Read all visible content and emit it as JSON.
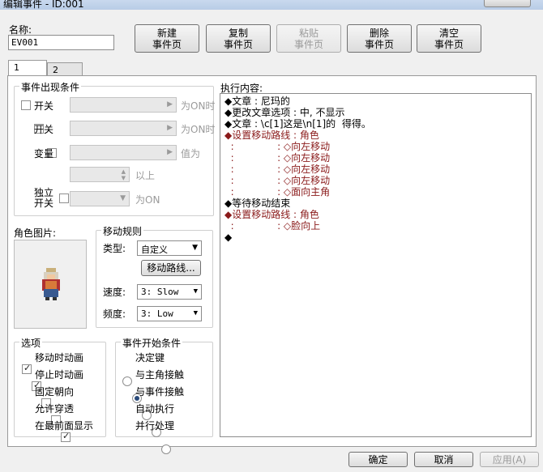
{
  "window": {
    "title": "编辑事件 - ID:001"
  },
  "name_field": {
    "label": "名称:",
    "value": "EV001"
  },
  "toolbar": {
    "new_page": [
      "新建",
      "事件页"
    ],
    "copy_page": [
      "复制",
      "事件页"
    ],
    "paste_page": [
      "粘贴",
      "事件页"
    ],
    "delete_page": [
      "删除",
      "事件页"
    ],
    "clear_page": [
      "清空",
      "事件页"
    ]
  },
  "tabs": [
    "1",
    "2"
  ],
  "conditions": {
    "title": "事件出现条件",
    "switch1": {
      "label": "开关",
      "suffix": "为ON时"
    },
    "switch2": {
      "label": "开关",
      "suffix": "为ON时"
    },
    "variable": {
      "label": "变量",
      "suffix": "值为",
      "above": "以上"
    },
    "self_switch": {
      "label1": "独立",
      "label2": "开关",
      "suffix": "为ON"
    }
  },
  "graphic": {
    "title": "角色图片:"
  },
  "movement": {
    "title": "移动规则",
    "type_label": "类型:",
    "type_value": "自定义",
    "route_button": "移动路线...",
    "speed_label": "速度:",
    "speed_value": "3: Slow",
    "freq_label": "频度:",
    "freq_value": "3: Low"
  },
  "options": {
    "title": "选项",
    "items": [
      {
        "label": "移动时动画",
        "checked": true
      },
      {
        "label": "停止时动画",
        "checked": true
      },
      {
        "label": "固定朝向",
        "checked": false
      },
      {
        "label": "允许穿透",
        "checked": false
      },
      {
        "label": "在最前面显示",
        "checked": true
      }
    ]
  },
  "trigger": {
    "title": "事件开始条件",
    "items": [
      {
        "label": "决定键",
        "selected": false
      },
      {
        "label": "与主角接触",
        "selected": true
      },
      {
        "label": "与事件接触",
        "selected": false
      },
      {
        "label": "自动执行",
        "selected": false
      },
      {
        "label": "并行处理",
        "selected": false
      }
    ]
  },
  "contents": {
    "title": "执行内容:",
    "lines": [
      {
        "text": "◆文章 : 尼玛的",
        "red": false
      },
      {
        "text": "◆更改文章选项 : 中, 不显示",
        "red": false
      },
      {
        "text": "◆文章 : \\c[1]这是\\n[1]的  得得。",
        "red": false
      },
      {
        "text": "◆设置移动路线 : 角色",
        "red": true
      },
      {
        "text": "  :              : ◇向左移动",
        "red": true
      },
      {
        "text": "  :              : ◇向左移动",
        "red": true
      },
      {
        "text": "  :              : ◇向左移动",
        "red": true
      },
      {
        "text": "  :              : ◇向左移动",
        "red": true
      },
      {
        "text": "  :              : ◇面向主角",
        "red": true
      },
      {
        "text": "◆等待移动结束",
        "red": false
      },
      {
        "text": "◆设置移动路线 : 角色",
        "red": true
      },
      {
        "text": "  :              : ◇脸向上",
        "red": true
      },
      {
        "text": "◆",
        "red": false
      }
    ]
  },
  "footer": {
    "ok": "确定",
    "cancel": "取消",
    "apply": "应用(A)"
  }
}
